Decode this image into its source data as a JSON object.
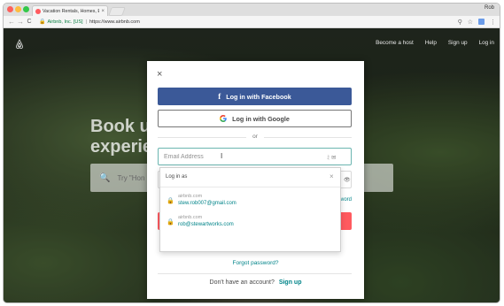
{
  "browser": {
    "tab_title": "Vacation Rentals, Homes, Exp",
    "tab_close": "×",
    "profile_name": "Rob",
    "site_identity": "Airbnb, Inc. [US]",
    "url_separator": "|",
    "url": "https://www.airbnb.com",
    "back_icon": "←",
    "forward_icon": "→",
    "reload_icon": "C",
    "lock_icon": "🔒",
    "search_icon": "⚲",
    "star_icon": "☆",
    "menu_icon": "⋮"
  },
  "page": {
    "nav": [
      "Become a host",
      "Help",
      "Sign up",
      "Log in"
    ],
    "hero_title_line1": "Book u",
    "hero_title_line2": "experie",
    "hero_search_icon": "🔍",
    "hero_search_placeholder": "Try \"Hon"
  },
  "modal": {
    "close_icon": "×",
    "facebook_icon": "f",
    "facebook_label": "Log in with Facebook",
    "google_label": "Log in with Google",
    "or_text": "or",
    "email_placeholder": "Email Address",
    "email_value": "",
    "input_cursor": "I",
    "input_icons": "ﾐ ✉",
    "ghost_eye": "👁",
    "ghost_word": "word",
    "forgot_password": "Forgot password?",
    "signup_prompt": "Don't have an account?",
    "signup_link": "Sign up"
  },
  "autofill": {
    "title": "Log in as",
    "close_icon": "×",
    "accounts": [
      {
        "site": "airbnb.com",
        "username": "stew.rob007@gmail.com",
        "lock_icon": "🔒"
      },
      {
        "site": "airbnb.com",
        "username": "rob@stewartworks.com",
        "lock_icon": "🔒"
      }
    ]
  },
  "colors": {
    "facebook_blue": "#3b5998",
    "airbnb_teal": "#008489",
    "airbnb_red": "#ff5a5f"
  }
}
